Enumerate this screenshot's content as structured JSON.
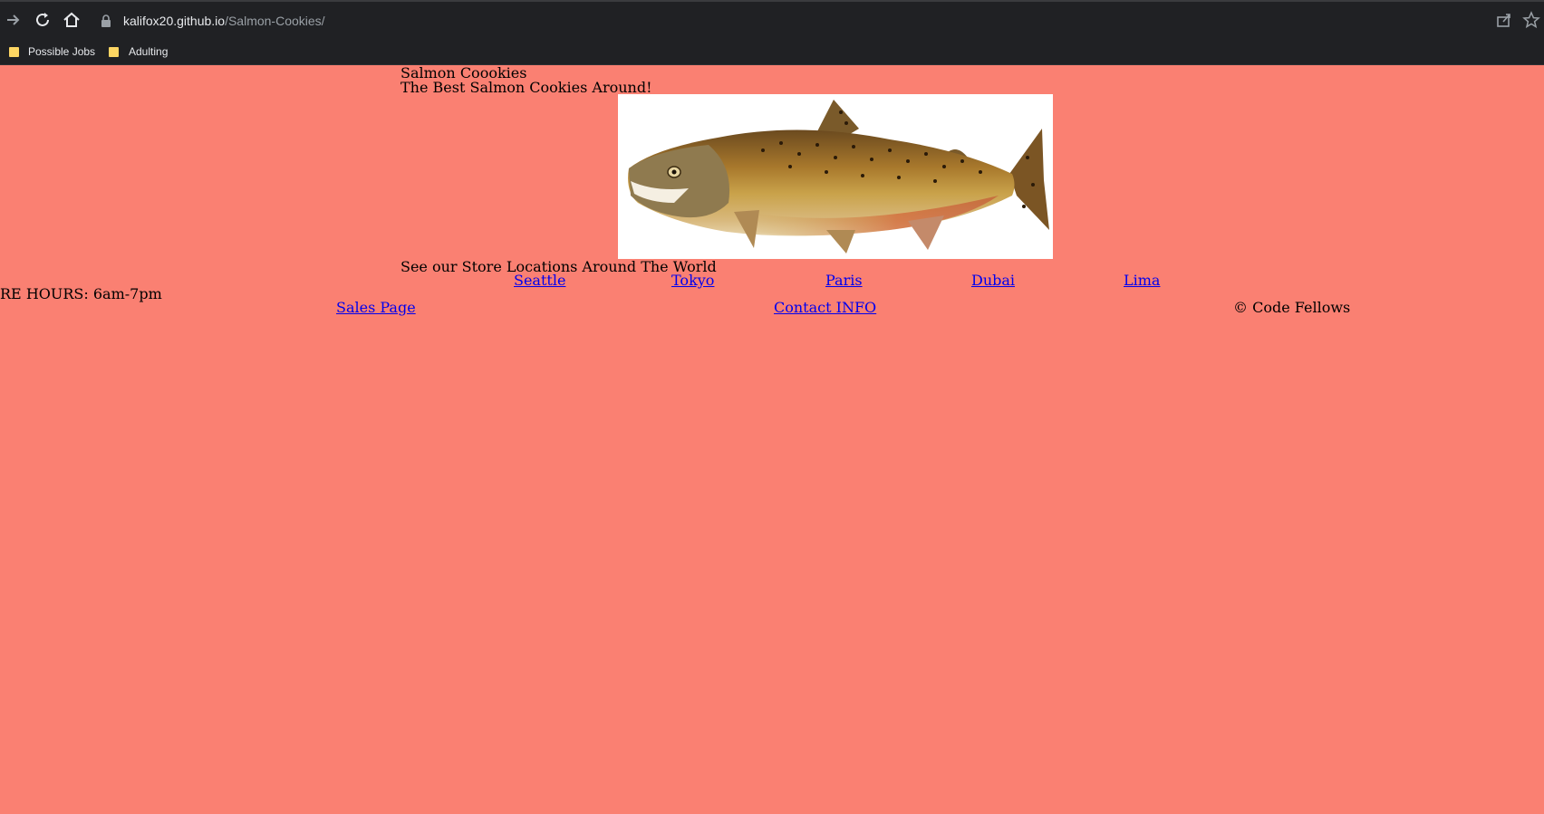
{
  "browser": {
    "url_host": "kalifox20.github.io",
    "url_path": "/Salmon-Cookies/",
    "bookmarks": [
      {
        "label": "Possible Jobs"
      },
      {
        "label": "Adulting"
      }
    ]
  },
  "page": {
    "site_title": "Salmon Coookies",
    "tagline": "The Best Salmon Cookies Around!",
    "locations_heading": "See our Store Locations Around The World",
    "locations": [
      {
        "label": "Seattle"
      },
      {
        "label": "Tokyo"
      },
      {
        "label": "Paris"
      },
      {
        "label": "Dubai"
      },
      {
        "label": "Lima"
      }
    ],
    "store_hours": "RE HOURS: 6am-7pm",
    "footer": {
      "sales_link": "Sales Page",
      "contact_link": "Contact INFO",
      "copyright": "© Code Fellows"
    }
  },
  "colors": {
    "page_background": "#fa8072",
    "link": "#0000ee",
    "browser_chrome": "#202124"
  }
}
